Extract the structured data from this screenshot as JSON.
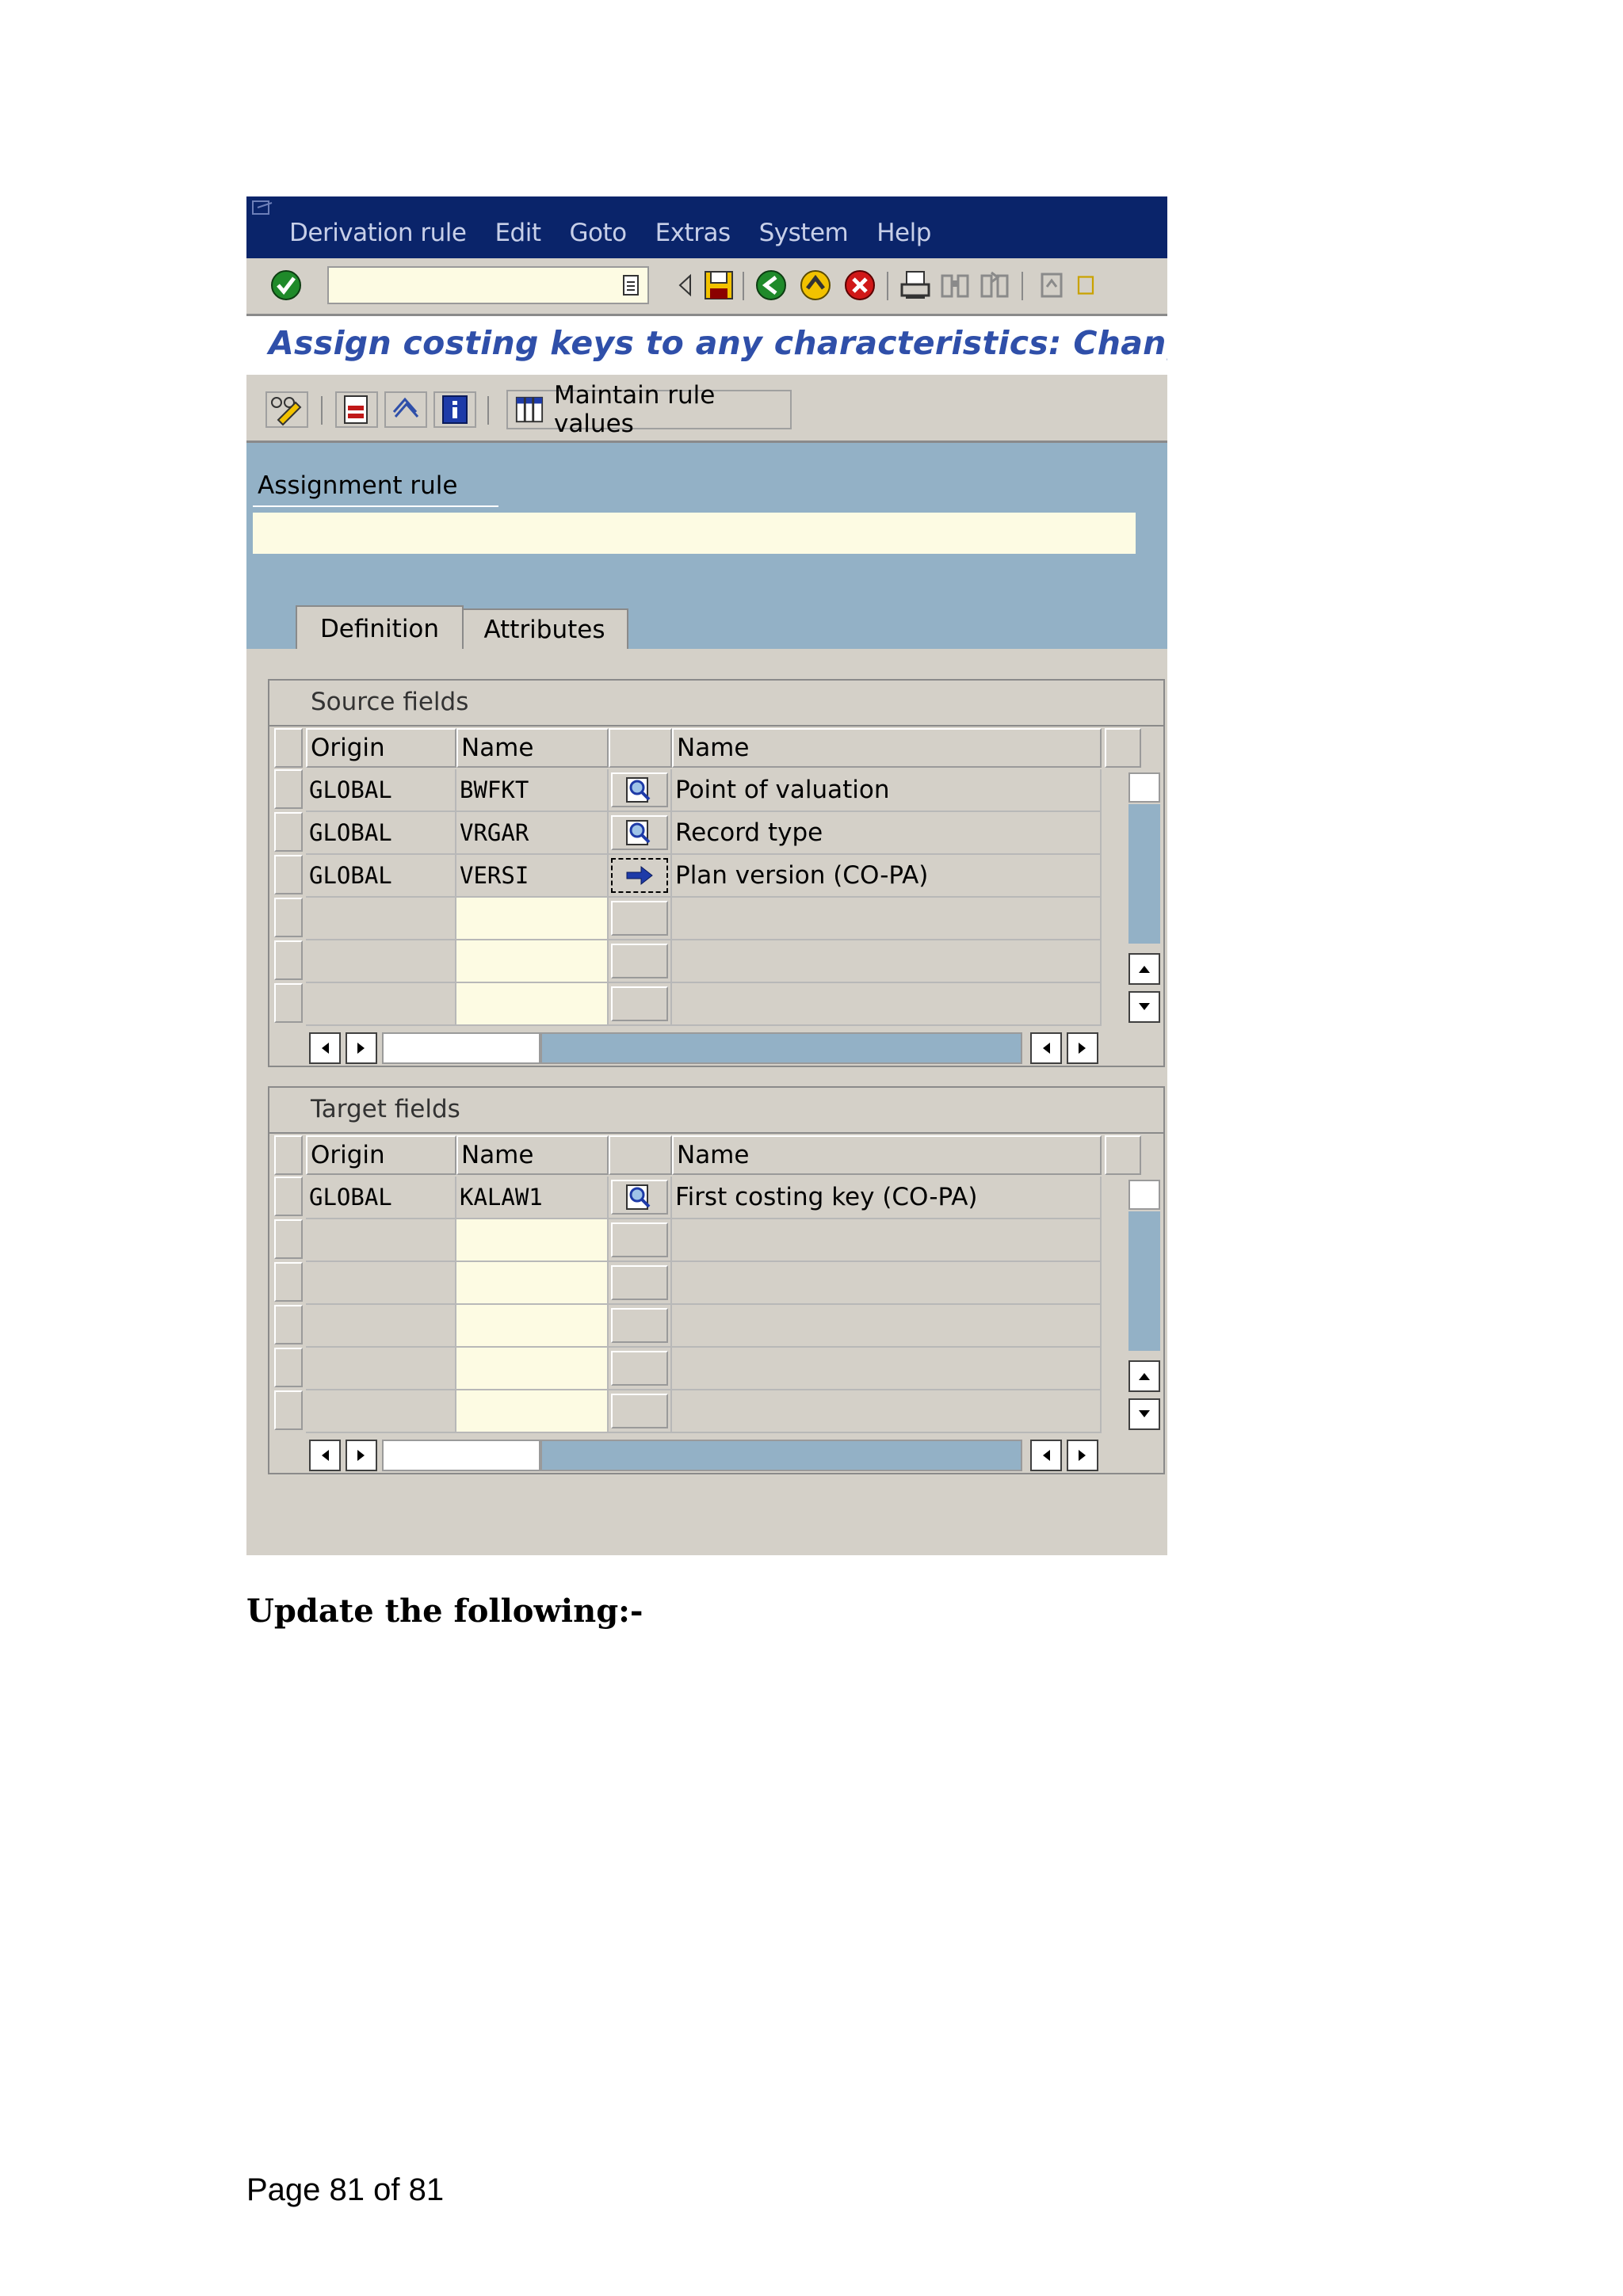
{
  "menu": {
    "items": [
      "Derivation rule",
      "Edit",
      "Goto",
      "Extras",
      "System",
      "Help"
    ]
  },
  "toolbar": {
    "command_value": ""
  },
  "title": "Assign costing keys to any characteristics: Change",
  "app_toolbar": {
    "maintain_label": "Maintain rule values"
  },
  "assignment": {
    "label": "Assignment rule",
    "value": ""
  },
  "tabs": {
    "definition": "Definition",
    "attributes": "Attributes"
  },
  "source": {
    "title": "Source fields",
    "headers": {
      "origin": "Origin",
      "name": "Name",
      "desc": "Name"
    },
    "rows": [
      {
        "origin": "GLOBAL",
        "name": "BWFKT",
        "desc": "Point of valuation",
        "icon": "search-icon"
      },
      {
        "origin": "GLOBAL",
        "name": "VRGAR",
        "desc": "Record type",
        "icon": "search-icon"
      },
      {
        "origin": "GLOBAL",
        "name": "VERSI",
        "desc": "Plan version (CO-PA)",
        "icon": "arrow-right-icon"
      }
    ]
  },
  "target": {
    "title": "Target fields",
    "headers": {
      "origin": "Origin",
      "name": "Name",
      "desc": "Name"
    },
    "rows": [
      {
        "origin": "GLOBAL",
        "name": "KALAW1",
        "desc": "First costing key (CO-PA)",
        "icon": "search-icon"
      }
    ]
  },
  "doc": {
    "update_text": "Update the following:-",
    "page_number": "Page 81 of 81"
  },
  "colors": {
    "menubar": "#0a246a",
    "title": "#2f4fa9",
    "panel": "#93b1c6",
    "input": "#fdfbe3"
  }
}
